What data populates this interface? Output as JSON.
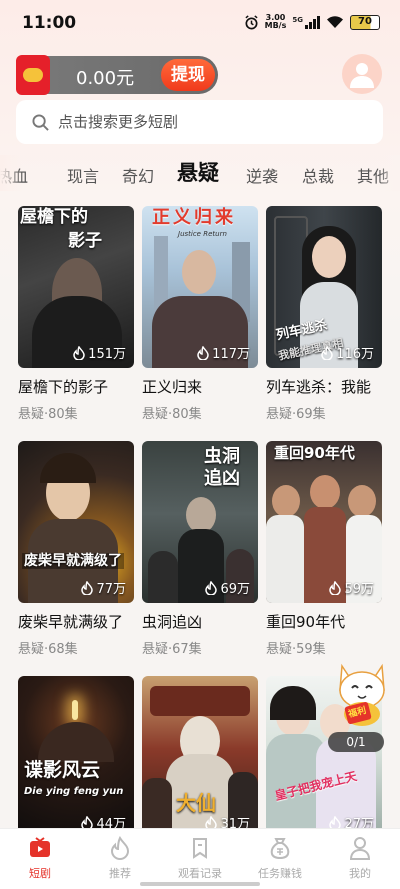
{
  "status_bar": {
    "time": "11:00",
    "net_speed_value": "3.00",
    "net_speed_unit": "MB/s",
    "network": "5G",
    "battery": "70"
  },
  "wallet": {
    "amount": "0.00元",
    "withdraw_label": "提现"
  },
  "search": {
    "placeholder": "点击搜索更多短剧"
  },
  "tabs": [
    {
      "label": "热血"
    },
    {
      "label": "现言"
    },
    {
      "label": "奇幻"
    },
    {
      "label": "悬疑",
      "active": true
    },
    {
      "label": "逆袭"
    },
    {
      "label": "总裁"
    },
    {
      "label": "其他"
    }
  ],
  "dramas": [
    {
      "title": "屋檐下的影子",
      "meta": "悬疑·80集",
      "views": "151万",
      "poster_line1": "屋檐下的",
      "poster_line2": "影子"
    },
    {
      "title": "正义归来",
      "meta": "悬疑·80集",
      "views": "117万",
      "poster_line1": "正义归来",
      "poster_line2": "Justice Return"
    },
    {
      "title": "列车逃杀：我能",
      "meta": "悬疑·69集",
      "views": "116万",
      "poster_line1": "列车逃杀",
      "poster_line2": "我能推理真相"
    },
    {
      "title": "废柴早就满级了",
      "meta": "悬疑·68集",
      "views": "77万",
      "poster_line1": "废柴早就满级了",
      "poster_line2": ""
    },
    {
      "title": "虫洞追凶",
      "meta": "悬疑·67集",
      "views": "69万",
      "poster_line1": "虫洞",
      "poster_line2": "追凶"
    },
    {
      "title": "重回90年代",
      "meta": "悬疑·59集",
      "views": "59万",
      "poster_line1": "重回90年代",
      "poster_line2": ""
    },
    {
      "title": "",
      "meta": "",
      "views": "44万",
      "poster_line1": "谍影风云",
      "poster_line2": "Die ying feng yun"
    },
    {
      "title": "",
      "meta": "",
      "views": "31万",
      "poster_line1": "大仙",
      "poster_line2": ""
    },
    {
      "title": "",
      "meta": "",
      "views": "27万",
      "poster_line1": "皇子把我宠上天",
      "poster_line2": ""
    }
  ],
  "floating": {
    "badge_text": "福利",
    "episode_counter": "0/1"
  },
  "bottom_nav": [
    {
      "label": "短剧",
      "icon": "tv-icon",
      "active": true
    },
    {
      "label": "推荐",
      "icon": "flame-icon"
    },
    {
      "label": "观看记录",
      "icon": "bookmark-icon"
    },
    {
      "label": "任务赚钱",
      "icon": "money-bag-icon"
    },
    {
      "label": "我的",
      "icon": "person-icon"
    }
  ],
  "colors": {
    "accent": "#e5332a",
    "wallet_bg": "#707070",
    "withdraw_btn": "#f2461f",
    "page_bg": "#f7f4f2"
  }
}
